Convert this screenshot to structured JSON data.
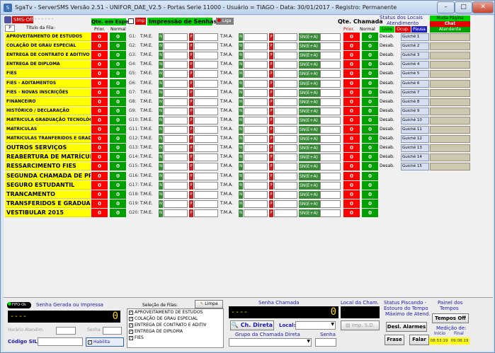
{
  "window": {
    "title": "SgaTv - ServerSMS Versão 2.51 - UNIFOR_DAE_V2.5 - Portas Serie 11000 - Usuário = TIAGO - Data: 30/01/2017 - Registro: Permanente",
    "icon": "app-icon"
  },
  "header": {
    "sms_status": "SMS-Off",
    "p_label": "P",
    "titulo_fila": "Título da Fila:",
    "qte_espera": "Qte. em Espera",
    "prior": "Prior.",
    "normal": "Normal",
    "imp_label": "Imp",
    "impressao": "Impressão de Senhas",
    "liga": "Liga",
    "qte_chamada": "Qte. Chamada",
    "prior2": "Prior.",
    "normal2": "Normal",
    "status_locais": "Status dos Locais",
    "atendimento": "Atendimento",
    "livre": "Livre",
    "ocup": "Ocup.",
    "pausa": "Pausa",
    "muda_pagina": "Muda Página",
    "chat": "Chat",
    "atendente": "Atendente"
  },
  "colors": {
    "yellow": "#ffff00",
    "red": "#ff0000",
    "green": "#00a000"
  },
  "tme_label": "T.M.E.",
  "tma_label": "T.M.A.",
  "sn_label": "SN(E+A)",
  "rows": [
    {
      "name": "APROVEITAMENTO DE ESTUDOS",
      "g": "G1:",
      "big": false
    },
    {
      "name": "COLAÇÃO DE GRAU ESPECIAL",
      "g": "G2:",
      "big": false
    },
    {
      "name": "ENTREGA DE CONTRATO E ADITIVO",
      "g": "G3:",
      "big": false
    },
    {
      "name": "ENTREGA DE DIPLOMA",
      "g": "G4:",
      "big": false
    },
    {
      "name": "FIES",
      "g": "G5:",
      "big": false
    },
    {
      "name": "FIES - ADITAMENTOS",
      "g": "G6:",
      "big": false
    },
    {
      "name": "FIES - NOVAS INSCRIÇÕES",
      "g": "G7:",
      "big": false
    },
    {
      "name": "FINANCEIRO",
      "g": "G8:",
      "big": false
    },
    {
      "name": "HISTÓRICO / DECLARAÇÃO",
      "g": "G9:",
      "big": false
    },
    {
      "name": "MATRICULA GRADUAÇÃO TECNOLÓGICA",
      "g": "G10:",
      "big": false
    },
    {
      "name": "MATRICULAS",
      "g": "G11:",
      "big": false
    },
    {
      "name": "MATRICULAS TRANFERIDOS E GRADUADOS",
      "g": "G12:",
      "big": false
    },
    {
      "name": "OUTROS SERVIÇOS",
      "g": "G13:",
      "big": true
    },
    {
      "name": "REABERTURA DE MATRÍCULA",
      "g": "G14:",
      "big": true
    },
    {
      "name": "RESSARCIMENTO FIES",
      "g": "G15:",
      "big": true
    },
    {
      "name": "SEGUNDA CHAMADA DE PROVA",
      "g": "G16:",
      "big": true
    },
    {
      "name": "SEGURO ESTUDANTIL",
      "g": "G17:",
      "big": true
    },
    {
      "name": "TRANCAMENTO",
      "g": "G18:",
      "big": true
    },
    {
      "name": "TRANSFERIDOS E GRADUADOS",
      "g": "G19:",
      "big": true
    },
    {
      "name": "VESTIBULAR 2015",
      "g": "G20:",
      "big": true
    }
  ],
  "counts": {
    "prior": "0",
    "normal": "0",
    "chamada_prior": "0",
    "chamada_normal": "0"
  },
  "guiches": [
    {
      "status": "Desab.",
      "label": "Guichê 1"
    },
    {
      "status": "Desab.",
      "label": "Guichê 2"
    },
    {
      "status": "Desab.",
      "label": "Guichê 3"
    },
    {
      "status": "Desab.",
      "label": "Guichê 4"
    },
    {
      "status": "Desab.",
      "label": "Guichê 5"
    },
    {
      "status": "Desab.",
      "label": "Guichê 6"
    },
    {
      "status": "Desab.",
      "label": "Guichê 7"
    },
    {
      "status": "Desab.",
      "label": "Guichê 8"
    },
    {
      "status": "Desab.",
      "label": "Guichê 9"
    },
    {
      "status": "Desab.",
      "label": "Guichê 10"
    },
    {
      "status": "Desab.",
      "label": "Guichê 11"
    },
    {
      "status": "Desab.",
      "label": "Guichê 12"
    },
    {
      "status": "Desab.",
      "label": "Guichê 13"
    },
    {
      "status": "Desab.",
      "label": "Guichê 14"
    },
    {
      "status": "Desab.",
      "label": "Guichê 15"
    }
  ],
  "bottom": {
    "fifo": "FIFO-Ok",
    "senha_gerada": "Senha Gerada ou Impressa",
    "lcd1_dash": "----",
    "lcd1_digit": "0",
    "horario": "Horário Atendim.",
    "senha": "Senha",
    "codigo_sil": "Código SIL:",
    "habilita": "Habilita",
    "selecao": "Seleção de Filas:",
    "limpa": "Limpa",
    "filas": [
      "APROVEITAMENTO DE ESTUDOS",
      "COLAÇÃO DE GRAU ESPECIAL",
      "ENTREGA DE CONTRATO E ADITIV",
      "ENTREGA DE DIPLOMA",
      "FIES"
    ],
    "senha_chamada": "Senha Chamada",
    "lcd2_dash": "----",
    "lcd2_digit": "0",
    "local_cham": "Local da Cham.",
    "ch_direta": "Ch. Direta",
    "local": "Local:",
    "imp_sd": "Imp. S.D.",
    "grupo_chamada": "Grupo da Chamada Direta",
    "senha2": "Senha",
    "status_piscando": "Status Piscando -",
    "estouro": "Estouro do Tempo",
    "maximo": "Máximo de Atend.",
    "desl_alarmes": "Desl. Alarmes",
    "frase": "Frase",
    "falar": "Falar",
    "painel": "Painel dos",
    "tempos": "Tempos",
    "tempos_off": "Tempos Off",
    "medicao": "Medição de:",
    "inicio": "Inicio",
    "final": "Final",
    "t_inicio": "08:53:19",
    "t_final": "09:08:19"
  }
}
